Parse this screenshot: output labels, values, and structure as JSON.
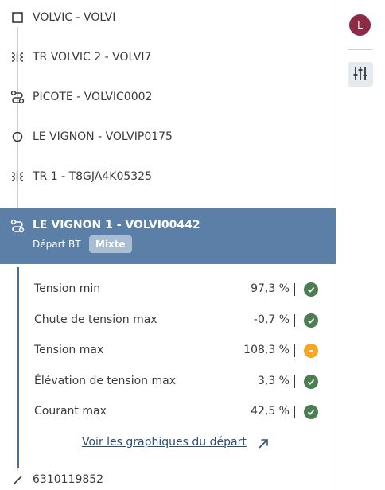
{
  "tree": {
    "items": [
      {
        "label": "VOLVIC - VOLVI",
        "icon": "square-icon"
      },
      {
        "label": "TR VOLVIC 2 - VOLVI7",
        "icon": "transformer-icon"
      },
      {
        "label": "PICOTE - VOLVIC0002",
        "icon": "feeder-icon"
      },
      {
        "label": "LE VIGNON - VOLVIP0175",
        "icon": "circle-icon"
      },
      {
        "label": "TR 1 - T8GJA4K05325",
        "icon": "transformer-icon"
      }
    ],
    "selected": {
      "title": "LE VIGNON 1 - VOLVI00442",
      "subtitle": "Départ BT",
      "badge": "Mixte",
      "icon": "feeder-icon"
    },
    "bottom": {
      "label": "6310119852",
      "icon": "line-segment-icon"
    }
  },
  "metrics": [
    {
      "name": "Tension min",
      "value": "97,3 %",
      "status": "ok"
    },
    {
      "name": "Chute de tension max",
      "value": "-0,7 %",
      "status": "ok"
    },
    {
      "name": "Tension max",
      "value": "108,3 %",
      "status": "warning"
    },
    {
      "name": "Élévation de tension max",
      "value": "3,3 %",
      "status": "ok"
    },
    {
      "name": "Courant max",
      "value": "42,5 %",
      "status": "ok"
    }
  ],
  "link": {
    "label": "Voir les graphiques du départ"
  },
  "sidebar": {
    "avatar_initial": "L"
  },
  "colors": {
    "selected_bg": "#5b7fa6",
    "ok": "#4b7f52",
    "warning": "#f5a623",
    "avatar": "#8b2b45",
    "link": "#2d4f73"
  }
}
